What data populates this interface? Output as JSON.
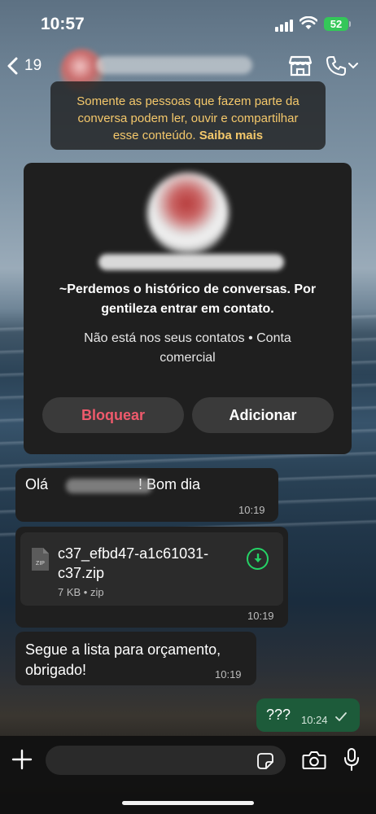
{
  "status_bar": {
    "time": "10:57",
    "battery": "52"
  },
  "header": {
    "back_count": "19"
  },
  "notice": {
    "line1": "Somente as pessoas que fazem parte da",
    "line2": "conversa podem ler, ouvir e compartilhar",
    "line3": "esse conteúdo.",
    "link": "Saiba mais"
  },
  "contact_card": {
    "about_line1": "~Perdemos o histórico de conversas. Por",
    "about_line2": "gentileza entrar em contato.",
    "meta_line1": "Não está nos seus contatos • Conta",
    "meta_line2": "comercial",
    "block_label": "Bloquear",
    "add_label": "Adicionar"
  },
  "messages": [
    {
      "text_start": "Olá ",
      "text_end": "! Bom dia",
      "time": "10:19"
    },
    {
      "file_name_line1": "c37_efbd47-a1c61031-",
      "file_name_line2": "c37.zip",
      "file_icon_label": "ZIP",
      "file_meta": "7 KB • zip",
      "time": "10:19"
    },
    {
      "text_line1": "Segue a lista para orçamento,",
      "text_line2": "obrigado!",
      "time": "10:19"
    },
    {
      "text": "???",
      "time": "10:24"
    }
  ],
  "colors": {
    "outgoing_bubble": "#1d5b3a",
    "incoming_bubble": "#1f1f1f",
    "notice_text": "#f4c86b",
    "block_red": "#ef5a6c",
    "accent_green": "#25d366",
    "battery_green": "#34c759"
  }
}
